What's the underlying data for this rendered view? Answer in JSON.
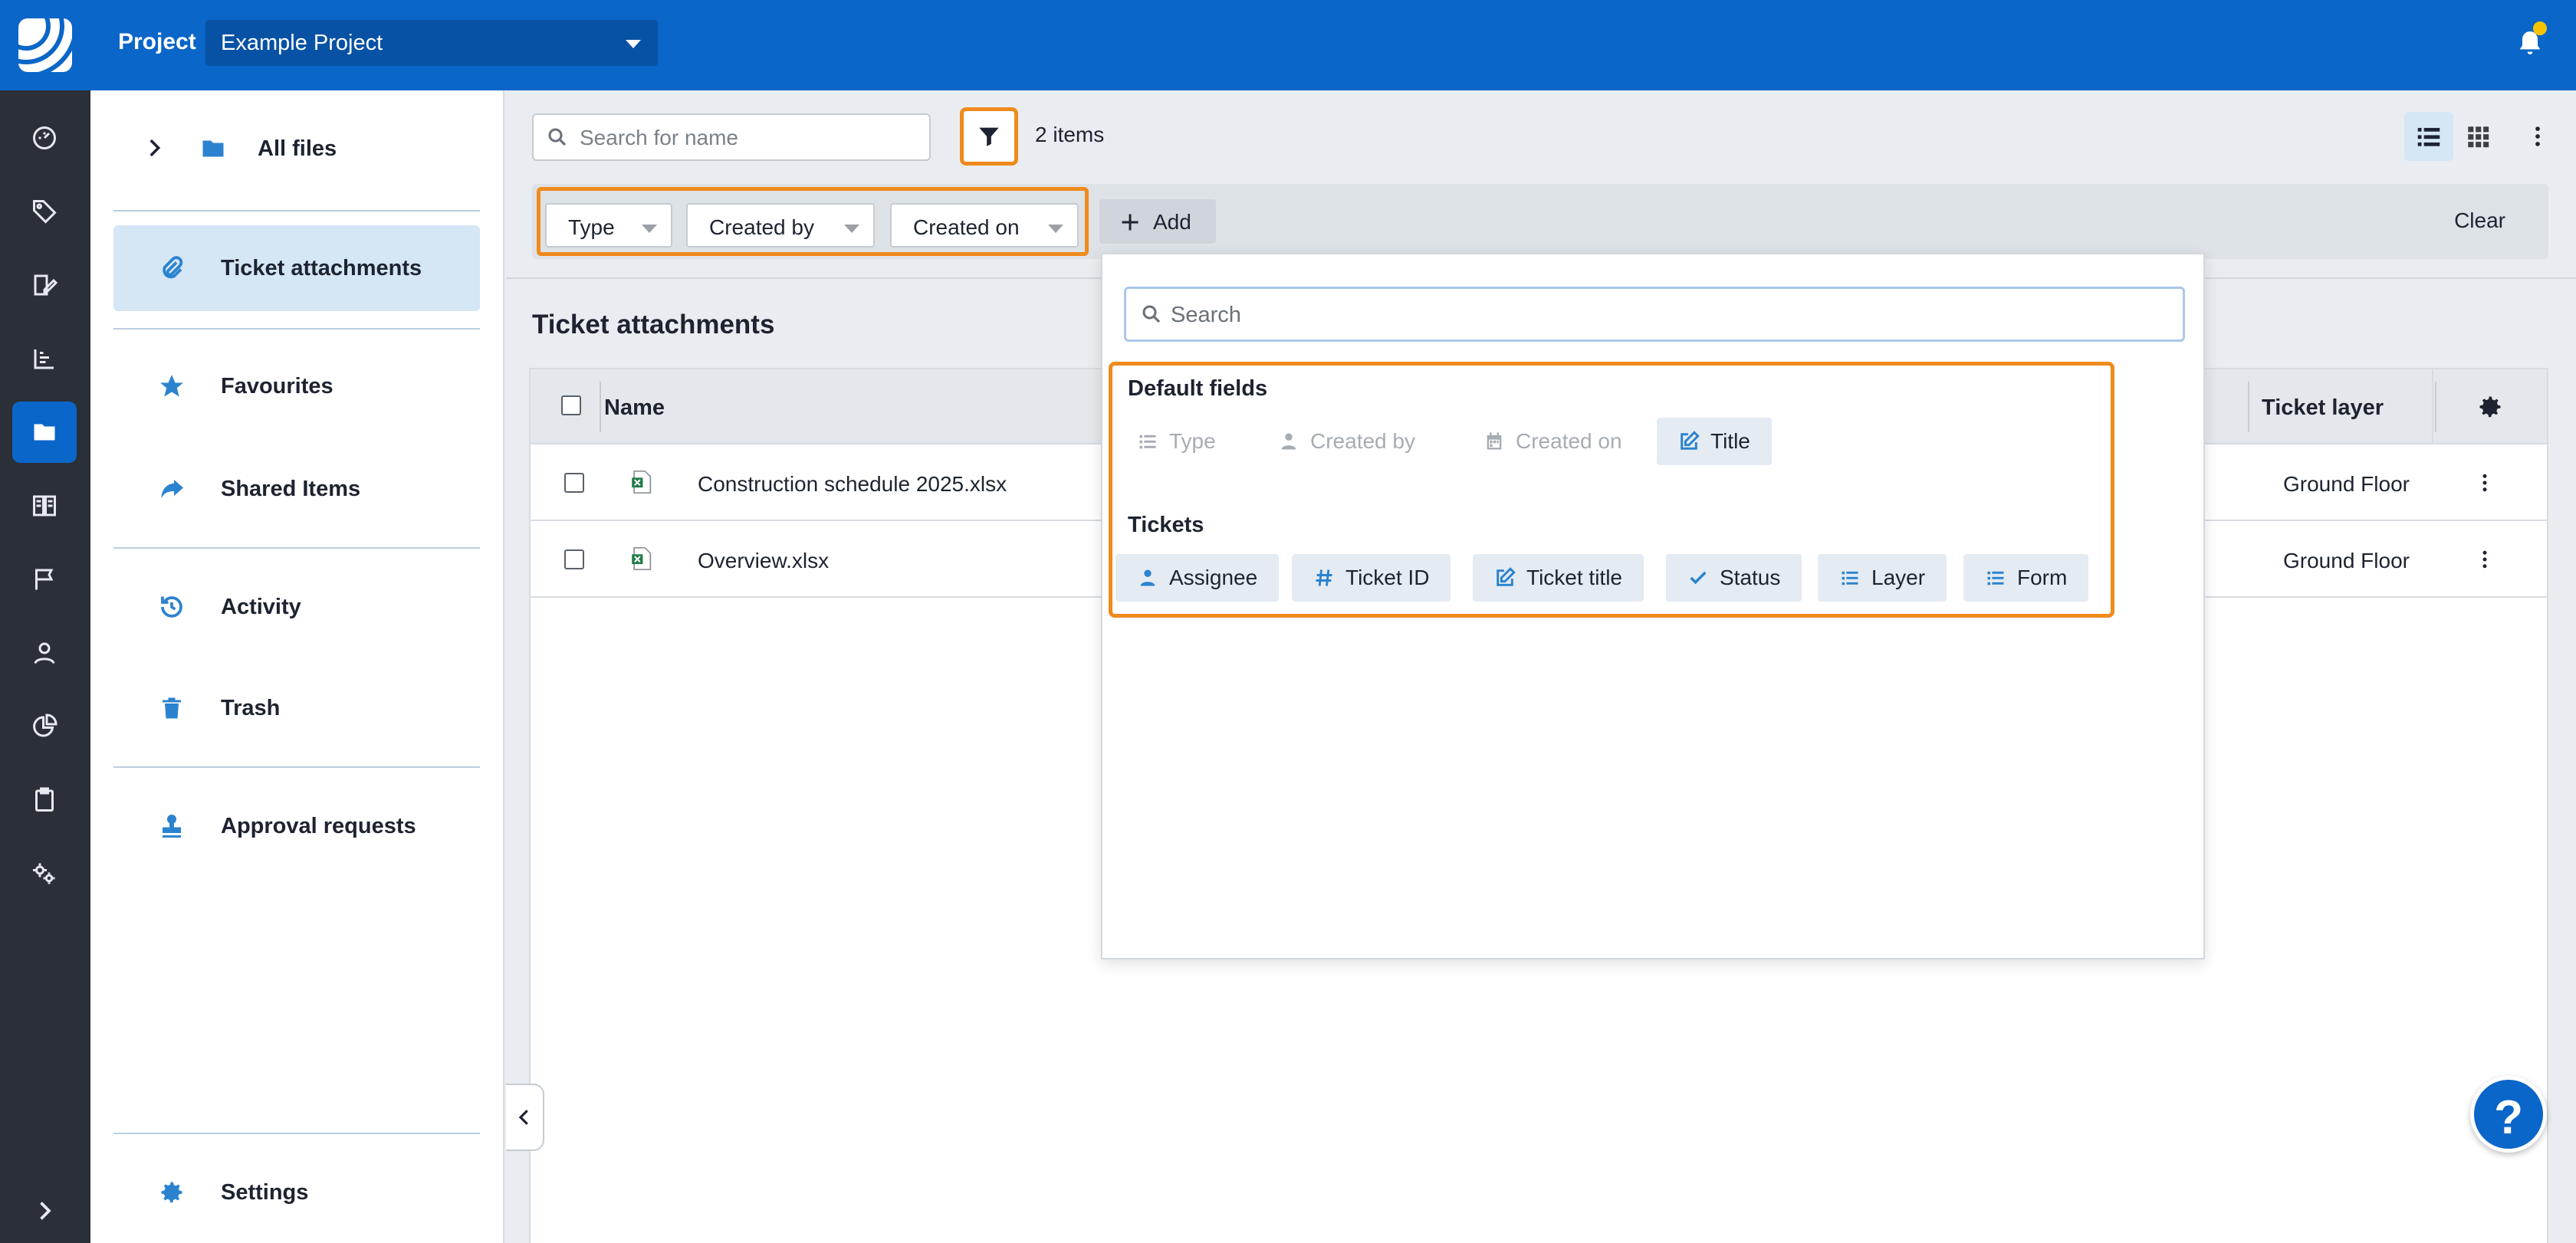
{
  "topbar": {
    "project_label": "Project",
    "project_value": "Example Project"
  },
  "rail": {
    "icons": [
      "dashboard-icon",
      "tag-icon",
      "plan-edit-icon",
      "chart-icon",
      "folder-icon",
      "book-icon",
      "flag-icon",
      "user-icon",
      "pie-chart-icon",
      "clipboard-icon",
      "settings-cogs-icon",
      "expand-chevron-icon"
    ]
  },
  "sidebar": {
    "items": [
      {
        "label": "All files",
        "icon": "folder-icon"
      },
      {
        "label": "Ticket attachments",
        "icon": "paperclip-icon"
      },
      {
        "label": "Favourites",
        "icon": "star-icon"
      },
      {
        "label": "Shared Items",
        "icon": "share-arrow-icon"
      },
      {
        "label": "Activity",
        "icon": "history-icon"
      },
      {
        "label": "Trash",
        "icon": "trash-icon"
      },
      {
        "label": "Approval requests",
        "icon": "stamp-icon"
      },
      {
        "label": "Settings",
        "icon": "gear-icon"
      }
    ]
  },
  "toolbar": {
    "search_placeholder": "Search for name",
    "item_count": "2 items"
  },
  "filters": {
    "chips": [
      "Type",
      "Created by",
      "Created on"
    ],
    "add_label": "Add",
    "clear_label": "Clear"
  },
  "main": {
    "section_title": "Ticket attachments"
  },
  "table": {
    "columns": {
      "name": "Name",
      "layer": "Ticket layer"
    },
    "rows": [
      {
        "name": "Construction schedule 2025.xlsx",
        "layer": "Ground Floor"
      },
      {
        "name": "Overview.xlsx",
        "layer": "Ground Floor"
      }
    ]
  },
  "panel": {
    "search_placeholder": "Search",
    "default_title": "Default fields",
    "default_fields": [
      {
        "label": "Type",
        "icon": "list-icon",
        "enabled": false
      },
      {
        "label": "Created by",
        "icon": "person-icon",
        "enabled": false
      },
      {
        "label": "Created on",
        "icon": "calendar-icon",
        "enabled": false
      },
      {
        "label": "Title",
        "icon": "edit-icon",
        "enabled": true
      }
    ],
    "tickets_title": "Tickets",
    "ticket_fields": [
      {
        "label": "Assignee",
        "icon": "person-icon"
      },
      {
        "label": "Ticket ID",
        "icon": "hash-icon"
      },
      {
        "label": "Ticket title",
        "icon": "edit-icon"
      },
      {
        "label": "Status",
        "icon": "check-icon"
      },
      {
        "label": "Layer",
        "icon": "list-icon"
      },
      {
        "label": "Form",
        "icon": "list-icon"
      }
    ]
  },
  "help": {
    "label": "?"
  },
  "colors": {
    "brand": "#0a66c8",
    "highlight": "#f08a1c",
    "notification": "#f7c300"
  }
}
